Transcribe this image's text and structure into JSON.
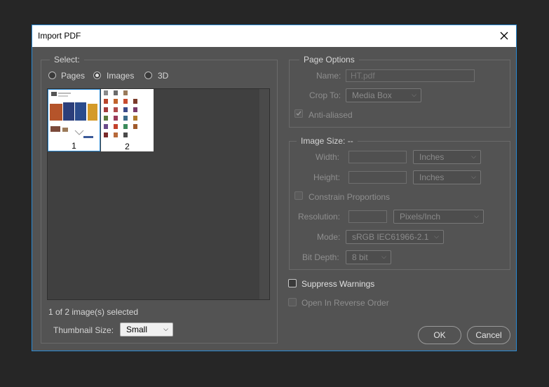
{
  "window": {
    "title": "Import PDF"
  },
  "select": {
    "legend": "Select:",
    "options": [
      {
        "label": "Pages",
        "selected": false
      },
      {
        "label": "Images",
        "selected": true
      },
      {
        "label": "3D",
        "selected": false
      }
    ],
    "thumbnails": [
      {
        "number": "1",
        "selected": true
      },
      {
        "number": "2",
        "selected": false
      }
    ],
    "status": "1 of 2 image(s) selected",
    "thumb_size_label": "Thumbnail Size:",
    "thumb_size_value": "Small"
  },
  "page_options": {
    "legend": "Page Options",
    "name_label": "Name:",
    "name_value": "HT.pdf",
    "crop_label": "Crop To:",
    "crop_value": "Media Box",
    "antialiased_label": "Anti-aliased",
    "antialiased_checked": true
  },
  "image_size": {
    "legend": "Image Size: --",
    "width_label": "Width:",
    "width_unit": "Inches",
    "height_label": "Height:",
    "height_unit": "Inches",
    "constrain_label": "Constrain Proportions",
    "resolution_label": "Resolution:",
    "resolution_unit": "Pixels/Inch",
    "mode_label": "Mode:",
    "mode_value": "sRGB IEC61966-2.1",
    "bitdepth_label": "Bit Depth:",
    "bitdepth_value": "8 bit"
  },
  "suppress_label": "Suppress Warnings",
  "reverse_label": "Open In Reverse Order",
  "buttons": {
    "ok": "OK",
    "cancel": "Cancel"
  },
  "colors": {
    "accent": "#2a8ad4",
    "dialog_bg": "#535353",
    "backdrop": "#262626"
  }
}
